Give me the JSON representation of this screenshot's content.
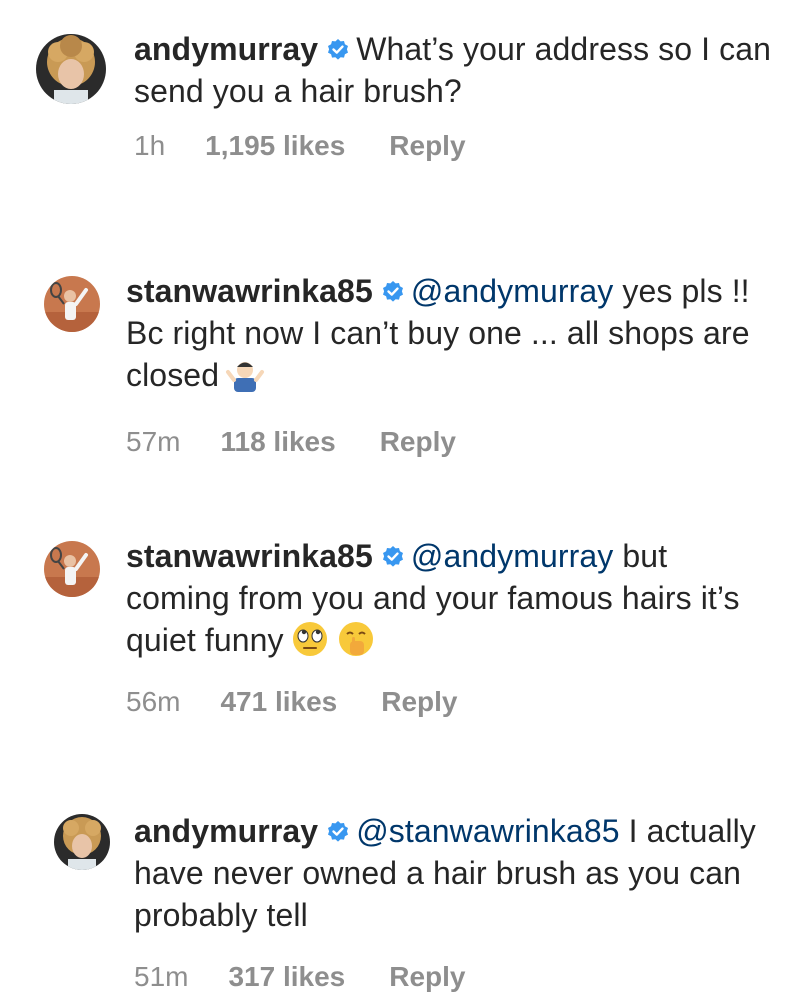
{
  "comments": [
    {
      "username": "andymurray",
      "verified": true,
      "mention": "",
      "text": "What’s your address so I can send you a hair brush?",
      "emoji": [],
      "time": "1h",
      "likes": "1,195 likes",
      "reply_label": "Reply",
      "avatar": "andymurray-avatar"
    },
    {
      "username": "stanwawrinka85",
      "verified": true,
      "mention": "@andymurray",
      "text": "yes pls !! Bc right now I can’t buy one ... all shops are closed",
      "emoji": [
        "person-shrugging-emoji"
      ],
      "time": "57m",
      "likes": "118 likes",
      "reply_label": "Reply",
      "avatar": "stanwawrinka85-avatar"
    },
    {
      "username": "stanwawrinka85",
      "verified": true,
      "mention": "@andymurray",
      "text": "but coming from you and your famous hairs it’s quiet funny",
      "emoji": [
        "face-with-rolling-eyes-emoji",
        "face-with-hand-over-mouth-emoji"
      ],
      "time": "56m",
      "likes": "471 likes",
      "reply_label": "Reply",
      "avatar": "stanwawrinka85-avatar"
    },
    {
      "username": "andymurray",
      "verified": true,
      "mention": "@stanwawrinka85",
      "text": "I actually have never owned a hair brush as you can probably tell",
      "emoji": [],
      "time": "51m",
      "likes": "317 likes",
      "reply_label": "Reply",
      "avatar": "andymurray-avatar"
    }
  ],
  "colors": {
    "text": "#262626",
    "meta": "#8e8e8e",
    "mention": "#00376b",
    "verified": "#3897f0"
  }
}
